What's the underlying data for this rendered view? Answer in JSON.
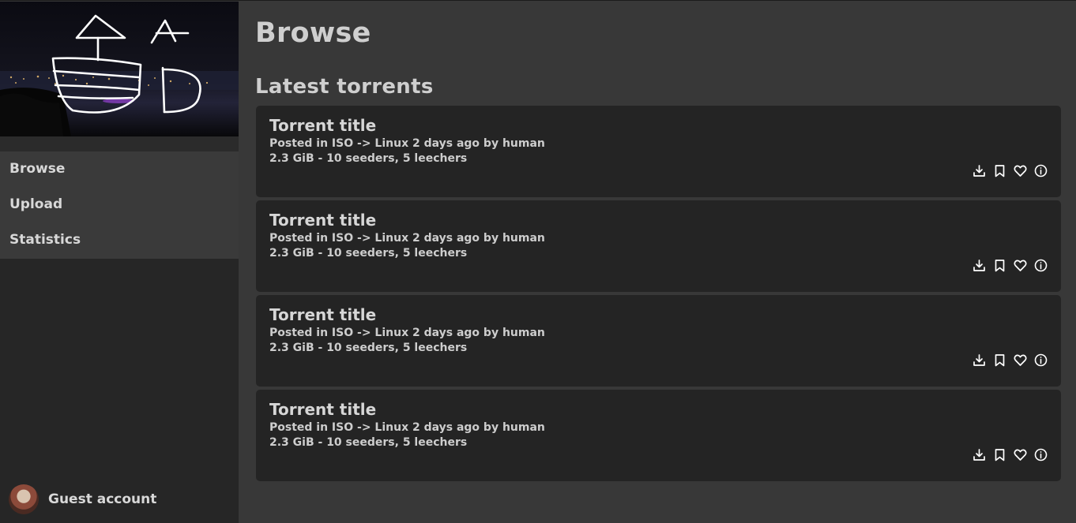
{
  "sidebar": {
    "logo_letters": [
      "A",
      "D"
    ],
    "nav": [
      {
        "label": "Browse"
      },
      {
        "label": "Upload"
      },
      {
        "label": "Statistics"
      }
    ],
    "user": {
      "name": "Guest account"
    }
  },
  "main": {
    "title": "Browse",
    "section_title": "Latest torrents",
    "torrents": [
      {
        "title": "Torrent title",
        "posted": "Posted in ISO -> Linux 2 days ago by human",
        "stats": "2.3 GiB - 10 seeders, 5 leechers"
      },
      {
        "title": "Torrent title",
        "posted": "Posted in ISO -> Linux 2 days ago by human",
        "stats": "2.3 GiB - 10 seeders, 5 leechers"
      },
      {
        "title": "Torrent title",
        "posted": "Posted in ISO -> Linux 2 days ago by human",
        "stats": "2.3 GiB - 10 seeders, 5 leechers"
      },
      {
        "title": "Torrent title",
        "posted": "Posted in ISO -> Linux 2 days ago by human",
        "stats": "2.3 GiB - 10 seeders, 5 leechers"
      }
    ],
    "actions": [
      {
        "icon": "download-icon"
      },
      {
        "icon": "bookmark-icon"
      },
      {
        "icon": "heart-icon"
      },
      {
        "icon": "info-icon"
      }
    ]
  }
}
